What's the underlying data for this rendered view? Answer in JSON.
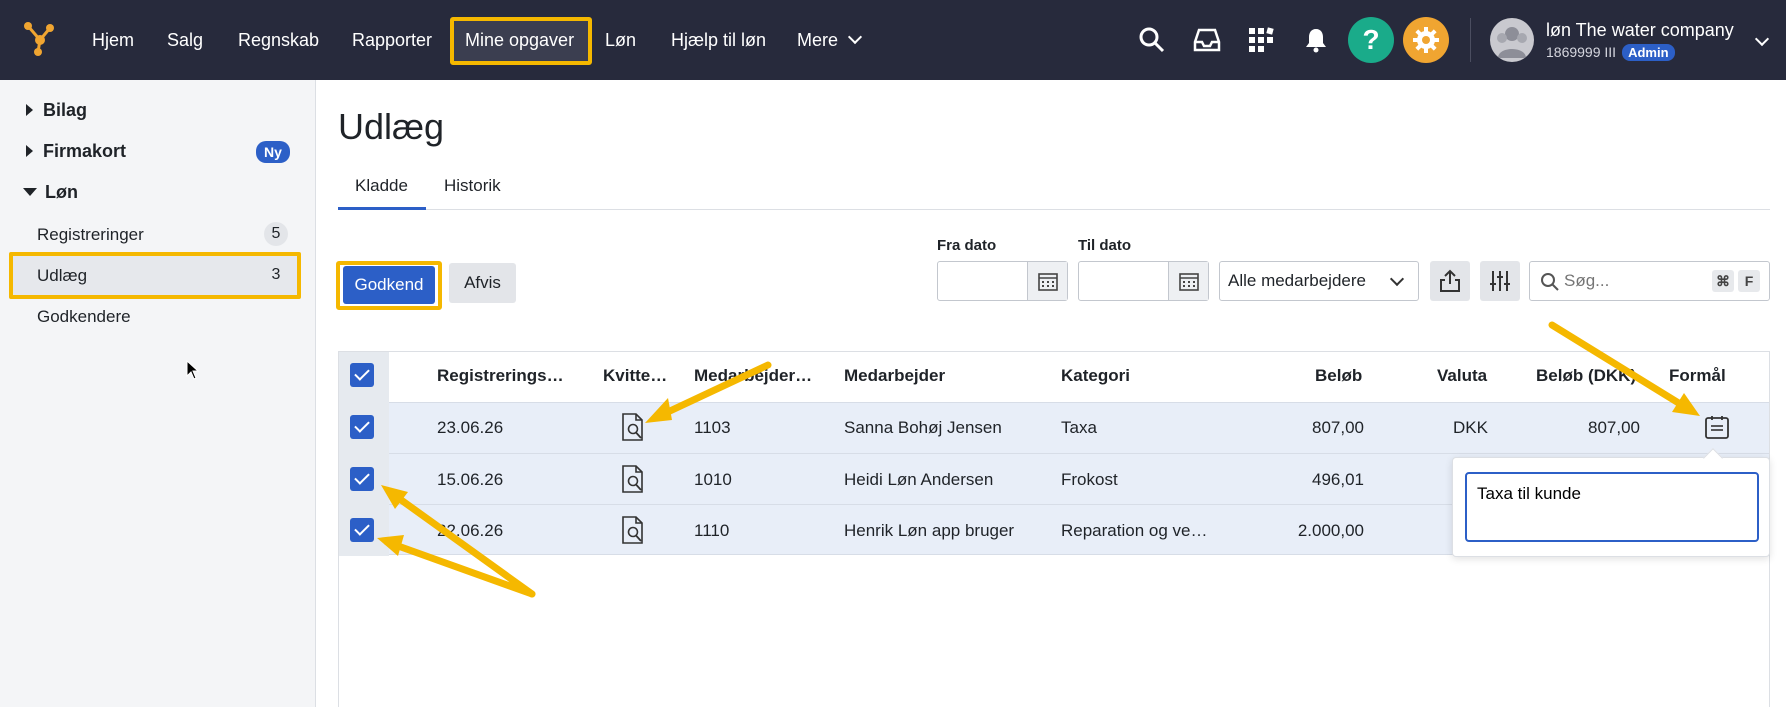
{
  "topbar": {
    "nav": [
      "Hjem",
      "Salg",
      "Regnskab",
      "Rapporter",
      "Mine opgaver",
      "Løn",
      "Hjælp til løn",
      "Mere"
    ],
    "company_name": "løn The water company",
    "company_id": "1869999 III",
    "admin_badge": "Admin",
    "help_glyph": "?",
    "icons": [
      "search-icon",
      "inbox-icon",
      "apps-icon",
      "bell-icon",
      "help-icon",
      "settings-icon"
    ],
    "colors": {
      "bg": "#272a3c",
      "help": "#1aab8a",
      "settings": "#f0a531",
      "highlight": "#f5b800"
    }
  },
  "sidebar": {
    "sections": [
      {
        "label": "Bilag",
        "expanded": false
      },
      {
        "label": "Firmakort",
        "expanded": false,
        "badge": "Ny"
      },
      {
        "label": "Løn",
        "expanded": true
      }
    ],
    "items": [
      {
        "label": "Registreringer",
        "count": "5"
      },
      {
        "label": "Udlæg",
        "count": "3",
        "active": true
      },
      {
        "label": "Godkendere"
      }
    ]
  },
  "main": {
    "title": "Udlæg",
    "tabs": [
      "Kladde",
      "Historik"
    ],
    "approve_label": "Godkend",
    "reject_label": "Afvis",
    "from_date_label": "Fra dato",
    "to_date_label": "Til dato",
    "employee_select": "Alle medarbejdere",
    "search_placeholder": "Søg...",
    "search_shortcut": [
      "⌘",
      "F"
    ]
  },
  "table": {
    "headers": [
      "Registrerings…",
      "Kvitte…",
      "Medarbejder…",
      "Medarbejder",
      "Kategori",
      "Beløb",
      "Valuta",
      "Beløb (DKK)",
      "Formål"
    ],
    "rows": [
      {
        "checked": true,
        "date": "23.06.26",
        "emp_no": "1103",
        "employee": "Sanna Bohøj Jensen",
        "category": "Taxa",
        "amount": "807,00",
        "currency": "DKK",
        "amount_dkk": "807,00"
      },
      {
        "checked": true,
        "date": "15.06.26",
        "emp_no": "1010",
        "employee": "Heidi Løn Andersen",
        "category": "Frokost",
        "amount": "496,01"
      },
      {
        "checked": true,
        "date": "22.06.26",
        "emp_no": "1110",
        "employee": "Henrik Løn app bruger",
        "category": "Reparation og ve…",
        "amount": "2.000,00"
      }
    ],
    "purpose_popover": "Taxa til kunde"
  }
}
